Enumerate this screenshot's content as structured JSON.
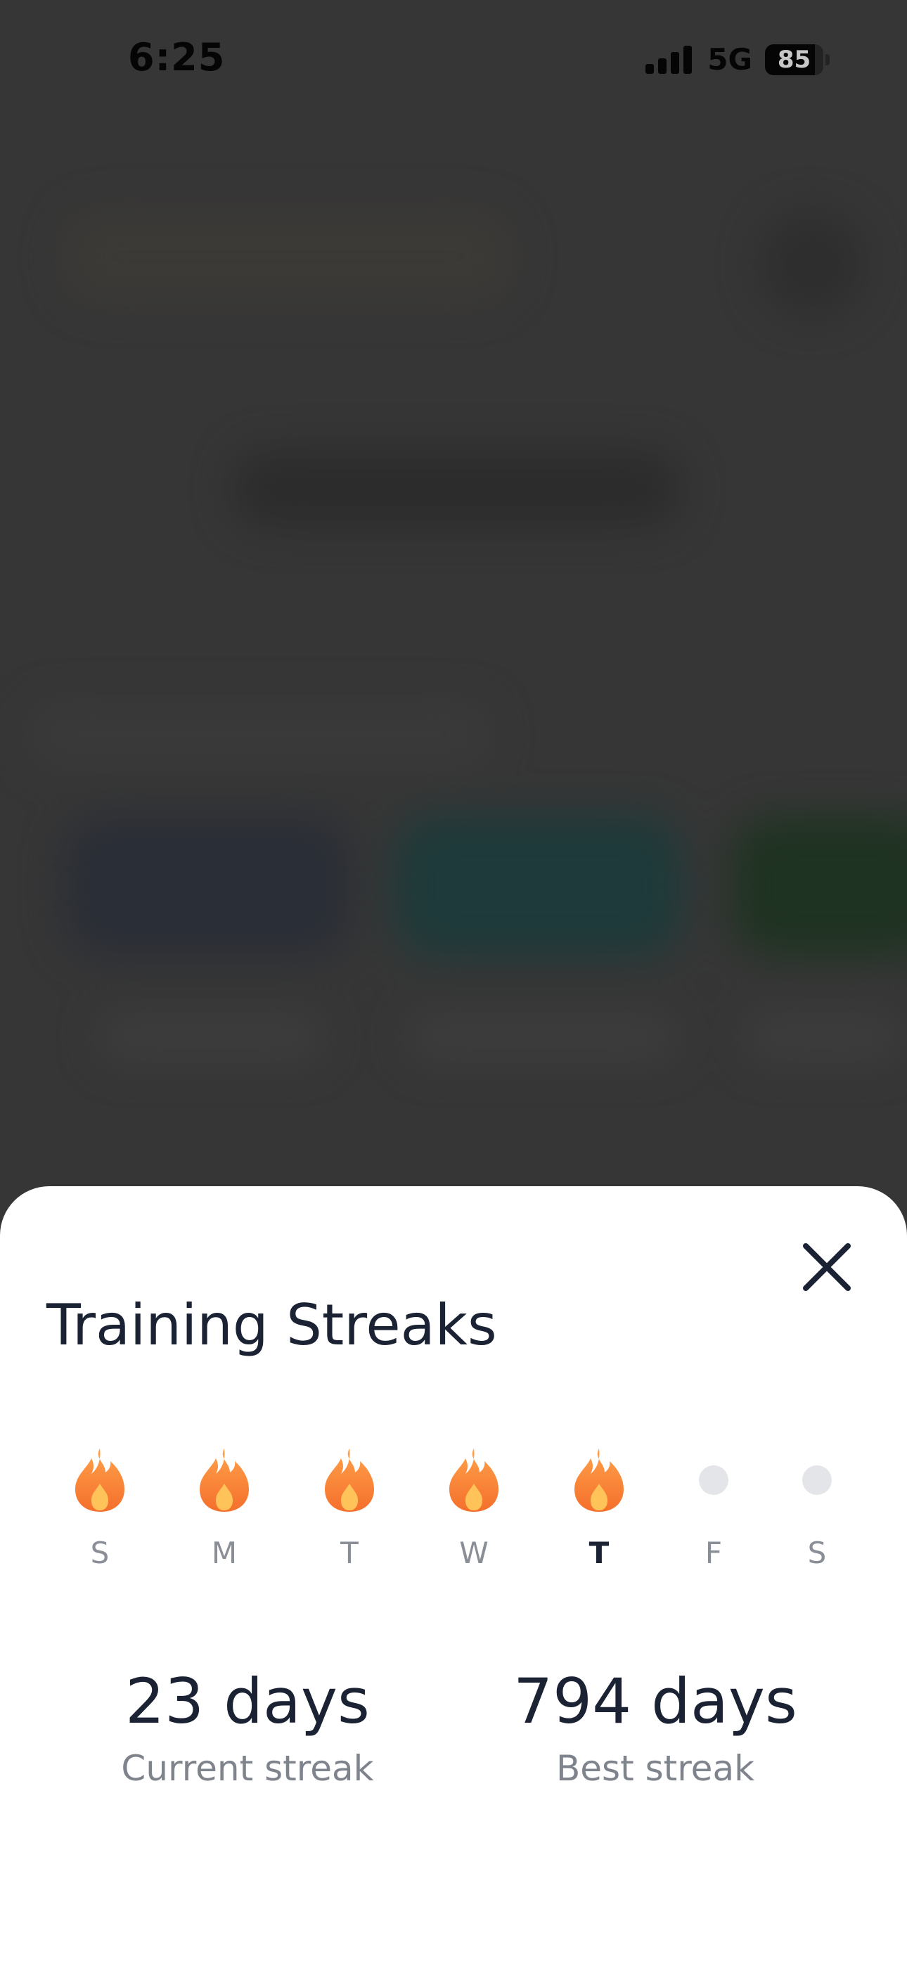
{
  "status_bar": {
    "time": "6:25",
    "network": "5G",
    "battery_percent": 85,
    "battery_label": "85",
    "icons": [
      "signal-bars-icon",
      "battery-icon"
    ]
  },
  "sheet": {
    "title": "Training Streaks",
    "close_icon": "close-icon",
    "days": [
      {
        "letter": "S",
        "completed": true,
        "today": false
      },
      {
        "letter": "M",
        "completed": true,
        "today": false
      },
      {
        "letter": "T",
        "completed": true,
        "today": false
      },
      {
        "letter": "W",
        "completed": true,
        "today": false
      },
      {
        "letter": "T",
        "completed": true,
        "today": true
      },
      {
        "letter": "F",
        "completed": false,
        "today": false
      },
      {
        "letter": "S",
        "completed": false,
        "today": false
      }
    ],
    "current_streak": {
      "value": "23 days",
      "label": "Current streak"
    },
    "best_streak": {
      "value": "794 days",
      "label": "Best streak"
    }
  },
  "colors": {
    "overlay": "#363636",
    "sheet_background": "#ffffff",
    "title_text": "#1a2233",
    "muted_text": "#8a8e96",
    "flame_outer": "#f7893b",
    "flame_inner": "#ffb347",
    "inactive_dot": "#e4e5e9"
  }
}
